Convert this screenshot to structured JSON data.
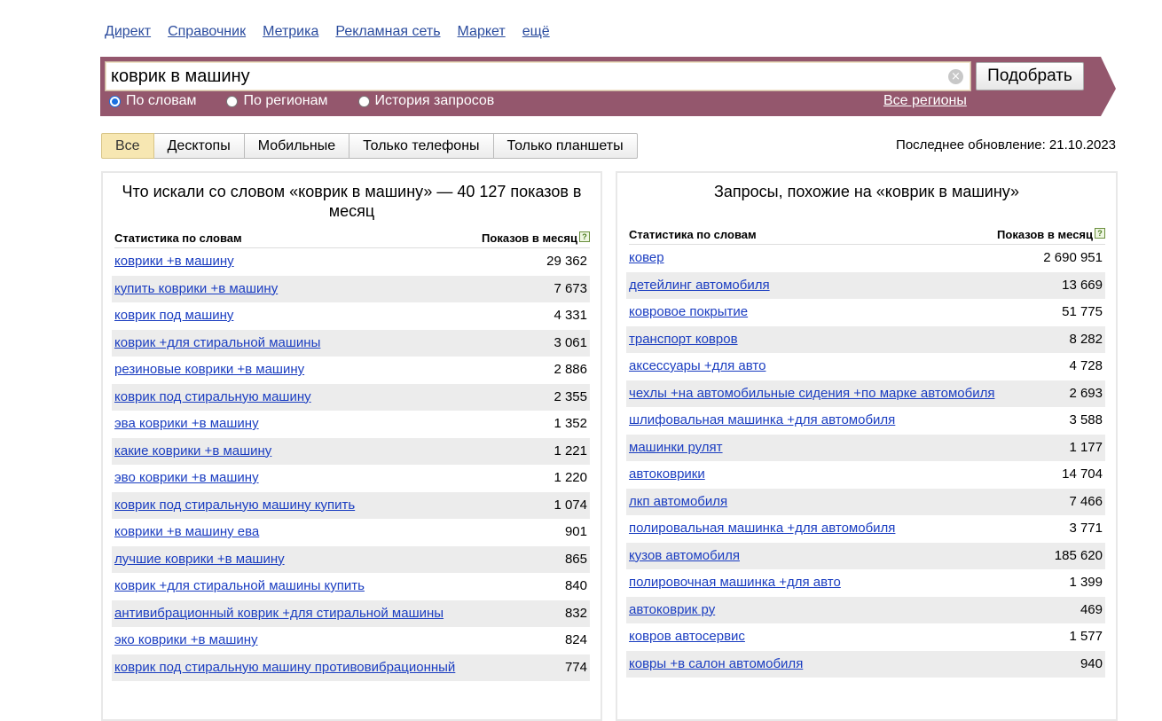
{
  "services": [
    "Директ",
    "Справочник",
    "Метрика",
    "Рекламная сеть",
    "Маркет",
    "ещё"
  ],
  "search": {
    "value": "коврик в машину",
    "clear_icon": "⊗",
    "submit_label": "Подобрать",
    "modes": [
      {
        "label": "По словам",
        "selected": true
      },
      {
        "label": "По регионам",
        "selected": false
      },
      {
        "label": "История запросов",
        "selected": false
      }
    ],
    "regions_label": "Все регионы"
  },
  "device_tabs": [
    {
      "label": "Все",
      "active": true
    },
    {
      "label": "Десктопы",
      "active": false
    },
    {
      "label": "Мобильные",
      "active": false
    },
    {
      "label": "Только телефоны",
      "active": false
    },
    {
      "label": "Только планшеты",
      "active": false
    }
  ],
  "last_update": "Последнее обновление: 21.10.2023",
  "left_panel": {
    "title": "Что искали со словом «коврик в машину» — 40 127 показов в месяц",
    "col_phrase": "Статистика по словам",
    "col_count": "Показов в месяц",
    "help_icon": "?",
    "rows": [
      {
        "phrase": "коврики +в машину",
        "count": "29 362"
      },
      {
        "phrase": "купить коврики +в машину",
        "count": "7 673"
      },
      {
        "phrase": "коврик под машину",
        "count": "4 331"
      },
      {
        "phrase": "коврик +для стиральной машины",
        "count": "3 061"
      },
      {
        "phrase": "резиновые коврики +в машину",
        "count": "2 886"
      },
      {
        "phrase": "коврик под стиральную машину",
        "count": "2 355"
      },
      {
        "phrase": "эва коврики +в машину",
        "count": "1 352"
      },
      {
        "phrase": "какие коврики +в машину",
        "count": "1 221"
      },
      {
        "phrase": "эво коврики +в машину",
        "count": "1 220"
      },
      {
        "phrase": "коврик под стиральную машину купить",
        "count": "1 074"
      },
      {
        "phrase": "коврики +в машину ева",
        "count": "901"
      },
      {
        "phrase": "лучшие коврики +в машину",
        "count": "865"
      },
      {
        "phrase": "коврик +для стиральной машины купить",
        "count": "840"
      },
      {
        "phrase": "антивибрационный коврик +для стиральной машины",
        "count": "832"
      },
      {
        "phrase": "эко коврики +в машину",
        "count": "824"
      },
      {
        "phrase": "коврик под стиральную машину противовибрационный",
        "count": "774"
      }
    ]
  },
  "right_panel": {
    "title": "Запросы, похожие на «коврик в машину»",
    "col_phrase": "Статистика по словам",
    "col_count": "Показов в месяц",
    "help_icon": "?",
    "rows": [
      {
        "phrase": "ковер",
        "count": "2 690 951"
      },
      {
        "phrase": "детейлинг автомобиля",
        "count": "13 669"
      },
      {
        "phrase": "ковровое покрытие",
        "count": "51 775"
      },
      {
        "phrase": "транспорт ковров",
        "count": "8 282"
      },
      {
        "phrase": "аксессуары +для авто",
        "count": "4 728"
      },
      {
        "phrase": "чехлы +на автомобильные сидения +по марке автомобиля",
        "count": "2 693"
      },
      {
        "phrase": "шлифовальная машинка +для автомобиля",
        "count": "3 588"
      },
      {
        "phrase": "машинки рулят",
        "count": "1 177"
      },
      {
        "phrase": "автоковрики",
        "count": "14 704"
      },
      {
        "phrase": "лкп автомобиля",
        "count": "7 466"
      },
      {
        "phrase": "полировальная машинка +для автомобиля",
        "count": "3 771"
      },
      {
        "phrase": "кузов автомобиля",
        "count": "185 620"
      },
      {
        "phrase": "полировочная машинка +для авто",
        "count": "1 399"
      },
      {
        "phrase": "автоковрик ру",
        "count": "469"
      },
      {
        "phrase": "ковров автосервис",
        "count": "1 577"
      },
      {
        "phrase": "ковры +в салон автомобиля",
        "count": "940"
      }
    ]
  }
}
